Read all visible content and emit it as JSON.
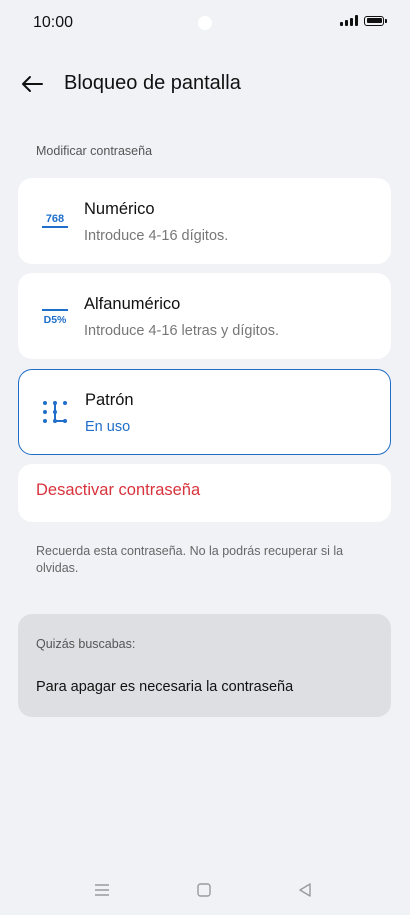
{
  "status": {
    "time": "10:00"
  },
  "header": {
    "title": "Bloqueo de pantalla"
  },
  "section": {
    "label": "Modificar contraseña"
  },
  "options": [
    {
      "title": "Numérico",
      "subtitle": "Introduce 4-16 dígitos.",
      "icon": "numeric-768-icon",
      "icon_text": "768"
    },
    {
      "title": "Alfanumérico",
      "subtitle": "Introduce 4-16 letras y dígitos.",
      "icon": "alphanumeric-d5-icon",
      "icon_text": "D5%"
    },
    {
      "title": "Patrón",
      "subtitle": "En uso",
      "icon": "pattern-dots-icon",
      "selected": true
    }
  ],
  "disable": {
    "label": "Desactivar contraseña"
  },
  "note": {
    "text": "Recuerda esta contraseña. No la podrás recuperar si la olvidas."
  },
  "suggestions": {
    "label": "Quizás buscabas:",
    "link": "Para apagar es necesaria la contraseña"
  },
  "colors": {
    "accent": "#1f6ec9",
    "danger": "#d8333d",
    "background": "#f1f2f6"
  },
  "nav": {
    "icons": [
      "menu-icon",
      "home-icon",
      "back-triangle-icon"
    ]
  }
}
